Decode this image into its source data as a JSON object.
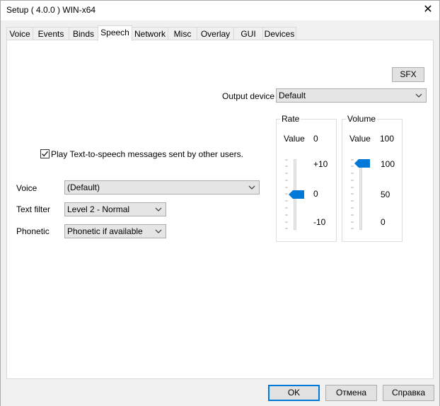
{
  "window": {
    "title": "Setup ( 4.0.0 ) WIN-x64",
    "close_glyph": "✕"
  },
  "tabs": [
    {
      "label": "Voice"
    },
    {
      "label": "Events"
    },
    {
      "label": "Binds"
    },
    {
      "label": "Speech",
      "active": true
    },
    {
      "label": "Network"
    },
    {
      "label": "Misc"
    },
    {
      "label": "Overlay"
    },
    {
      "label": "GUI"
    },
    {
      "label": "Devices"
    }
  ],
  "speech": {
    "sfx_label": "SFX",
    "output_device_label": "Output device",
    "output_device_value": "Default",
    "tts_checkbox_label": "Play Text-to-speech messages sent by other users.",
    "tts_checked": true,
    "voice_label": "Voice",
    "voice_value": "(Default)",
    "text_filter_label": "Text filter",
    "text_filter_value": "Level 2 - Normal",
    "phonetic_label": "Phonetic",
    "phonetic_value": "Phonetic if available",
    "rate": {
      "title": "Rate",
      "value_label": "Value",
      "value": "0",
      "max_label": "+10",
      "mid_label": "0",
      "min_label": "-10",
      "level": 0.5
    },
    "volume": {
      "title": "Volume",
      "value_label": "Value",
      "value": "100",
      "max_label": "100",
      "mid_label": "50",
      "min_label": "0",
      "level": 1.0
    }
  },
  "footer": {
    "ok_label": "OK",
    "cancel_label": "Отмена",
    "help_label": "Справка"
  },
  "colors": {
    "accent": "#0078d7"
  }
}
